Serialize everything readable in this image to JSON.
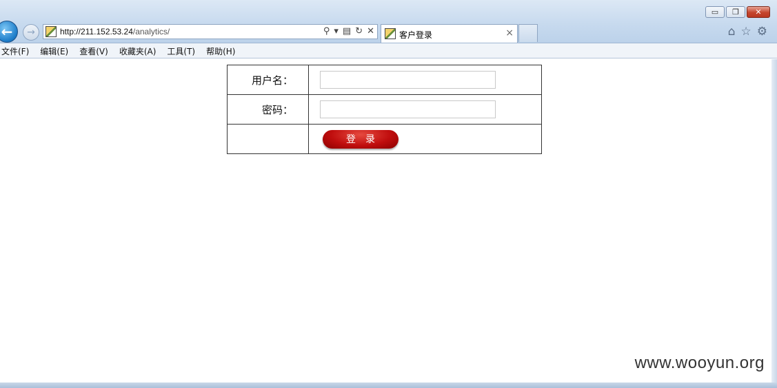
{
  "browser": {
    "url_host": "http://211.152.53.24",
    "url_path": "/analytics/",
    "tab_title": "客户登录",
    "tab_close": "×",
    "window_buttons": {
      "minimize": "▭",
      "maximize": "❐",
      "close": "✕"
    },
    "back": "←",
    "forward": "→",
    "addr_icons": [
      "search-icon",
      "dropdown-icon",
      "compat-icon",
      "refresh-icon",
      "stop-icon"
    ],
    "right_icons": [
      "home-icon",
      "favorites-star-icon",
      "settings-gear-icon"
    ]
  },
  "menubar": {
    "items": [
      "文件(F)",
      "编辑(E)",
      "查看(V)",
      "收藏夹(A)",
      "工具(T)",
      "帮助(H)"
    ]
  },
  "login_form": {
    "username_label": "用户名：",
    "password_label": "密码：",
    "username_value": "",
    "password_value": "",
    "submit_label": "登录"
  },
  "watermark": "www.wooyun.org"
}
